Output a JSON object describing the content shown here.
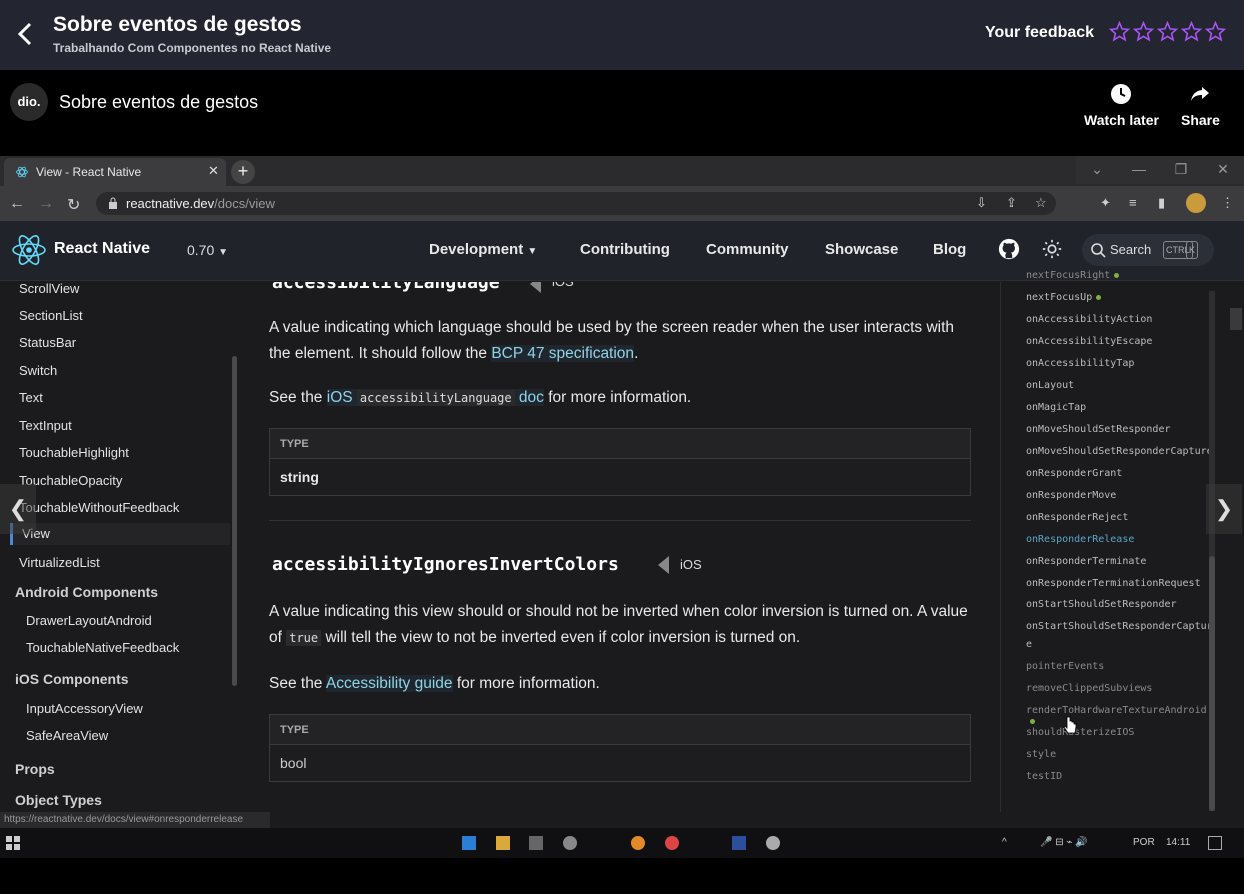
{
  "course": {
    "title": "Sobre eventos de gestos",
    "subtitle": "Trabalhando Com Componentes no React Native",
    "feedback_label": "Your feedback",
    "star_color": "#a855f7"
  },
  "video": {
    "logo_text": "dio.",
    "title": "Sobre eventos de gestos",
    "watch_later": "Watch later",
    "share": "Share"
  },
  "browser": {
    "tab_title": "View - React Native",
    "url_host": "reactnative.dev",
    "url_path": "/docs/view",
    "status_url": "https://reactnative.dev/docs/view#onresponderrelease"
  },
  "rn_nav": {
    "brand": "React Native",
    "version": "0.70",
    "links": [
      "Development",
      "Contributing",
      "Community",
      "Showcase",
      "Blog"
    ],
    "search": "Search",
    "kbd1": "CTRL",
    "kbd2": "K"
  },
  "sidebar": {
    "items": [
      "ScrollView",
      "SectionList",
      "StatusBar",
      "Switch",
      "Text",
      "TextInput",
      "TouchableHighlight",
      "TouchableOpacity",
      "TouchableWithoutFeedback",
      "View",
      "VirtualizedList"
    ],
    "android_head": "Android Components",
    "android_items": [
      "DrawerLayoutAndroid",
      "TouchableNativeFeedback"
    ],
    "ios_head": "iOS Components",
    "ios_items": [
      "InputAccessoryView",
      "SafeAreaView"
    ],
    "props": "Props",
    "object_types": "Object Types"
  },
  "doc": {
    "sec1_title": "accessibilityLanguage",
    "ios": "iOS",
    "sec1_p1a": "A value indicating which language should be used by the screen reader when the user interacts with the element. It should follow the ",
    "sec1_p1_link": "BCP 47 specification",
    "sec1_p2a": "See the ",
    "sec1_p2_link1": "iOS ",
    "sec1_p2_code": "accessibilityLanguage",
    "sec1_p2_link2": " doc",
    "sec1_p2b": " for more information.",
    "type_label": "TYPE",
    "sec1_type": "string",
    "sec2_title": "accessibilityIgnoresInvertColors",
    "sec2_p1a": "A value indicating this view should or should not be inverted when color inversion is turned on. A value of ",
    "sec2_p1_code": "true",
    "sec2_p1b": " will tell the view to not be inverted even if color inversion is turned on.",
    "sec2_p2a": "See the ",
    "sec2_p2_link": "Accessibility guide",
    "sec2_p2b": " for more information.",
    "sec2_type": "bool"
  },
  "toc": {
    "items": [
      "nextFocusRight",
      "nextFocusUp",
      "onAccessibilityAction",
      "onAccessibilityEscape",
      "onAccessibilityTap",
      "onLayout",
      "onMagicTap",
      "onMoveShouldSetResponder",
      "onMoveShouldSetResponderCapture",
      "onResponderGrant",
      "onResponderMove",
      "onResponderReject",
      "onResponderRelease",
      "onResponderTerminate",
      "onResponderTerminationRequest",
      "onStartShouldSetResponder",
      "onStartShouldSetResponderCaptur",
      "e",
      "pointerEvents",
      "removeClippedSubviews",
      "renderToHardwareTextureAndroid",
      "shouldRasterizeIOS",
      "style",
      "testID"
    ]
  },
  "taskbar": {
    "lang": "POR",
    "time": "14:11"
  }
}
